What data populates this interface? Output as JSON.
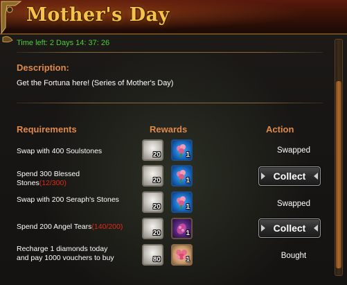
{
  "window": {
    "title": "Mother's Day",
    "time_left": "Time left: 2 Days  14: 37: 26"
  },
  "description": {
    "heading": "Description:",
    "text": "Get the Fortuna here! (Series of Mother's Day)"
  },
  "columns": {
    "requirements": "Requirements",
    "rewards": "Rewards",
    "action": "Action"
  },
  "rows": [
    {
      "requirement": "Swap with 400 Soulstones",
      "progress": "",
      "rewards": [
        {
          "icon": "white-stone-icon",
          "qty": "20"
        },
        {
          "icon": "rose-bouquet-icon",
          "qty": "1"
        }
      ],
      "action": "Swapped"
    },
    {
      "requirement": "Spend 300 Blessed Stones",
      "progress": "(12/300)",
      "rewards": [
        {
          "icon": "white-stone-icon",
          "qty": "20"
        },
        {
          "icon": "rose-bouquet-icon",
          "qty": "1"
        }
      ],
      "action": "Collect"
    },
    {
      "requirement": "Swap with 200 Seraph's Stones",
      "progress": "",
      "rewards": [
        {
          "icon": "white-stone-icon",
          "qty": "20"
        },
        {
          "icon": "rose-bouquet-icon",
          "qty": "1"
        }
      ],
      "action": "Swapped"
    },
    {
      "requirement": "Spend 200 Angel Tears",
      "progress": "(140/200)",
      "rewards": [
        {
          "icon": "white-stone-icon",
          "qty": "20"
        },
        {
          "icon": "flower-vial-icon",
          "qty": "1"
        }
      ],
      "action": "Collect"
    },
    {
      "requirement": "Recharge 1 diamonds today and pay 1000 vouchers to buy",
      "progress": "",
      "rewards": [
        {
          "icon": "white-stone-icon",
          "qty": "80"
        },
        {
          "icon": "rose-box-icon",
          "qty": "1"
        }
      ],
      "action": "Bought"
    }
  ],
  "colors": {
    "title": "#f7c24a",
    "time_left": "#4ccf3a",
    "heading": "#e08a4a",
    "progress": "#e02a1a"
  }
}
